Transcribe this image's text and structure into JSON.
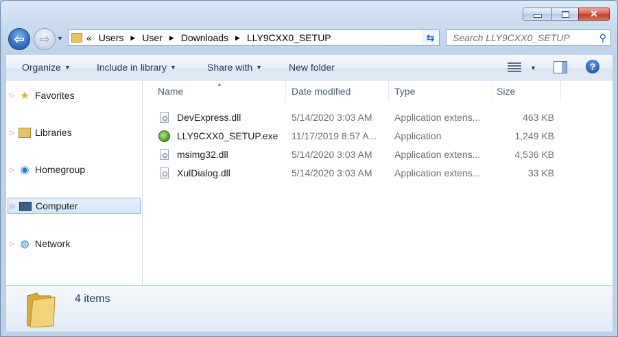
{
  "window": {
    "caption": {
      "minimize": "▁",
      "maximize": "□",
      "close": "✕"
    }
  },
  "nav": {
    "back_icon": "back-arrow-icon",
    "forward_icon": "forward-arrow-icon",
    "address": {
      "prefix": "«",
      "crumbs": [
        "Users",
        "User",
        "Downloads",
        "LLY9CXX0_SETUP"
      ]
    },
    "search": {
      "placeholder": "Search LLY9CXX0_SETUP"
    }
  },
  "toolbar": {
    "organize": "Organize",
    "include_in_library": "Include in library",
    "share_with": "Share with",
    "new_folder": "New folder"
  },
  "sidebar": {
    "items": [
      {
        "label": "Favorites",
        "icon": "star-icon"
      },
      {
        "label": "Libraries",
        "icon": "libraries-icon"
      },
      {
        "label": "Homegroup",
        "icon": "homegroup-icon"
      },
      {
        "label": "Computer",
        "icon": "computer-icon",
        "selected": true
      },
      {
        "label": "Network",
        "icon": "network-icon"
      }
    ]
  },
  "file_list": {
    "columns": [
      "Name",
      "Date modified",
      "Type",
      "Size"
    ],
    "rows": [
      {
        "name": "DevExpress.dll",
        "date": "5/14/2020 3:03 AM",
        "type": "Application extens...",
        "size": "463 KB",
        "icon": "dll-file-icon"
      },
      {
        "name": "LLY9CXX0_SETUP.exe",
        "date": "11/17/2019 8:57 A...",
        "type": "Application",
        "size": "1,249 KB",
        "icon": "setup-exe-icon"
      },
      {
        "name": "msimg32.dll",
        "date": "5/14/2020 3:03 AM",
        "type": "Application extens...",
        "size": "4,536 KB",
        "icon": "dll-file-icon"
      },
      {
        "name": "XulDialog.dll",
        "date": "5/14/2020 3:03 AM",
        "type": "Application extens...",
        "size": "33 KB",
        "icon": "dll-file-icon"
      }
    ]
  },
  "details": {
    "count": "4 items"
  },
  "colors": {
    "selection": "#d2e6fa",
    "link": "#1e395b",
    "close_red": "#c13c22"
  }
}
